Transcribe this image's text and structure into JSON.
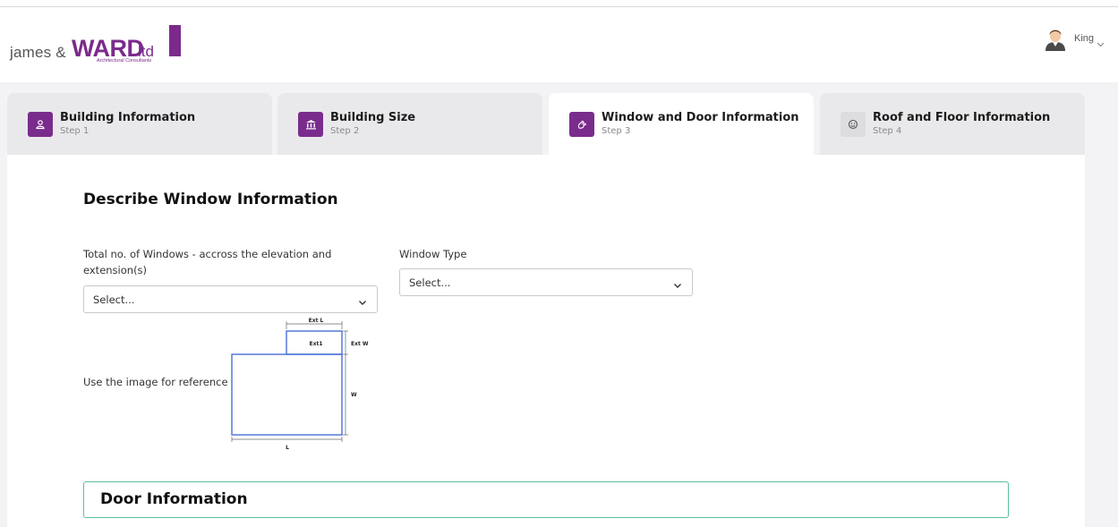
{
  "brand": {
    "logo_james": "james &",
    "logo_ward": "WARD",
    "logo_ltd": "ltd",
    "logo_subtitle": "Architectural Consultants",
    "accent_color": "#7b2a8c"
  },
  "user": {
    "name": "King",
    "avatar_icon": "user-avatar-icon",
    "menu_icon": "chevron-down-icon"
  },
  "steps": [
    {
      "title": "Building Information",
      "step": "Step 1",
      "icon": "person-icon",
      "active": false
    },
    {
      "title": "Building Size",
      "step": "Step 2",
      "icon": "building-icon",
      "active": false
    },
    {
      "title": "Window and Door Information",
      "step": "Step 3",
      "icon": "hand-icon",
      "active": true
    },
    {
      "title": "Roof and Floor Information",
      "step": "Step 4",
      "icon": "smiley-icon",
      "active": false
    }
  ],
  "window_section": {
    "title": "Describe Window Information",
    "total_windows_label": "Total no. of Windows - accross the elevation and extension(s)",
    "total_windows_value": "Select...",
    "window_type_label": "Window Type",
    "window_type_value": "Select...",
    "reference_label": "Use the image for reference",
    "diagram": {
      "ext_l": "Ext L",
      "ext1": "Ext1",
      "ext_w": "Ext W",
      "w": "W",
      "l": "L"
    }
  },
  "door_section": {
    "title": "Door Information",
    "border_color": "#5cbf9a"
  }
}
